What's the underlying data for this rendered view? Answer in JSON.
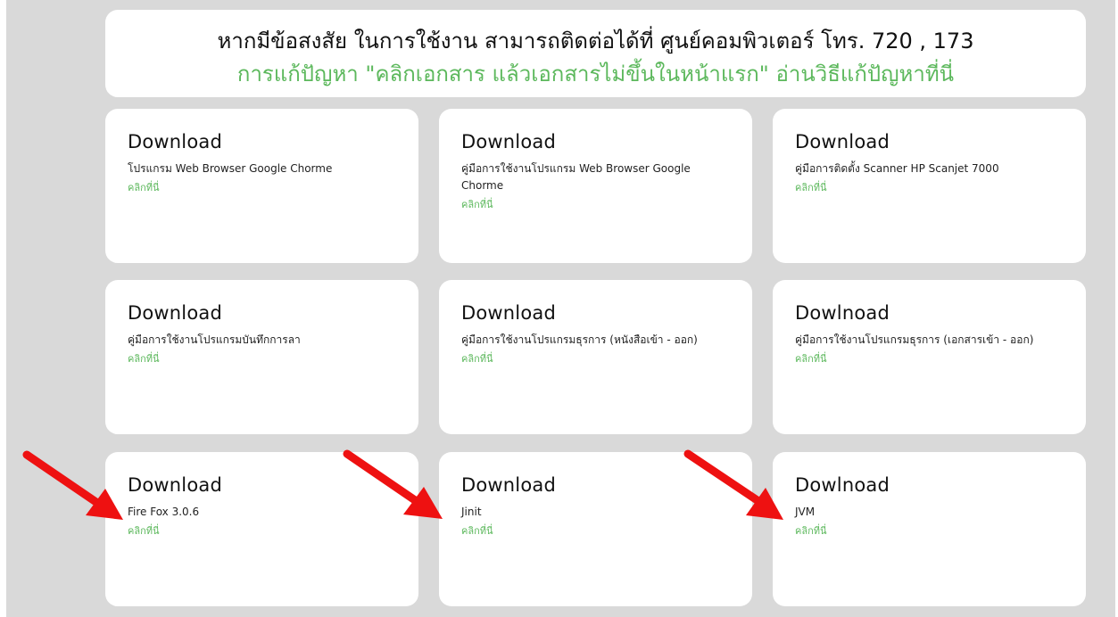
{
  "notice": {
    "contact_text": "หากมีข้อสงสัย ในการใช้งาน สามารถติดต่อได้ที่ ศูนย์คอมพิวเตอร์ โทร. 720 , 173",
    "fix_link_text": "การแก้ปัญหา \"คลิกเอกสาร แล้วเอกสารไม่ขึ้นในหน้าแรก\" อ่านวิธีแก้ปัญหาที่นี่"
  },
  "cards": [
    {
      "title": "Download",
      "description": "โปรแกรม Web Browser Google Chorme",
      "link": "คลิกที่นี่"
    },
    {
      "title": "Download",
      "description": "คู่มือการใช้งานโปรแกรม Web Browser Google Chorme",
      "link": "คลิกที่นี่"
    },
    {
      "title": "Download",
      "description": "คู่มือการติดตั้ง Scanner HP Scanjet 7000",
      "link": "คลิกที่นี่"
    },
    {
      "title": "Download",
      "description": "คู่มือการใช้งานโปรแกรมบันทึกการลา",
      "link": "คลิกที่นี่"
    },
    {
      "title": "Download",
      "description": "คู่มือการใช้งานโปรแกรมธุรการ (หนังสือเข้า - ออก)",
      "link": "คลิกที่นี่"
    },
    {
      "title": "Dowlnoad",
      "description": "คู่มือการใช้งานโปรแกรมธุรการ (เอกสารเข้า - ออก)",
      "link": "คลิกที่นี่"
    },
    {
      "title": "Download",
      "description": "Fire Fox 3.0.6",
      "link": "คลิกที่นี่"
    },
    {
      "title": "Download",
      "description": "Jinit",
      "link": "คลิกที่นี่"
    },
    {
      "title": "Dowlnoad",
      "description": "JVM",
      "link": "คลิกที่นี่"
    }
  ],
  "colors": {
    "accent_green": "#5cb85c",
    "annotation_red": "#ee1111",
    "page_gray": "#d9d9d9"
  }
}
